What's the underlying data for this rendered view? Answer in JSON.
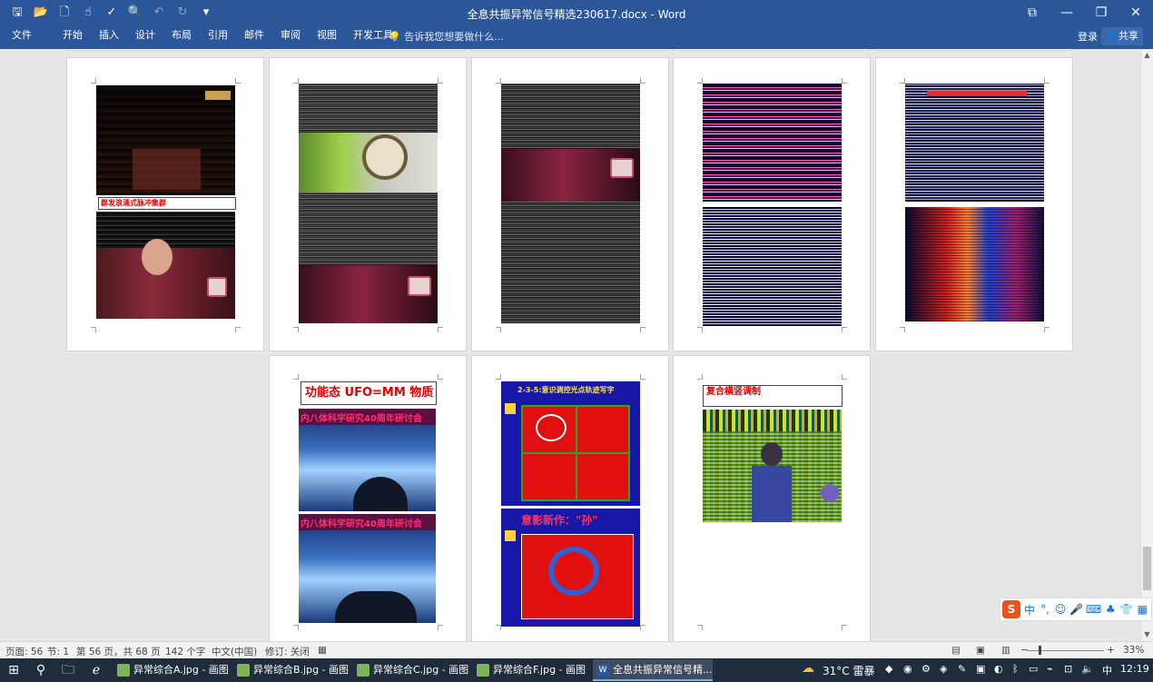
{
  "title_bar": {
    "document_title": "全息共振异常信号精选230617.docx - Word",
    "quick_access": [
      "save-icon",
      "open-icon",
      "new-doc-icon",
      "touch-mode-icon",
      "spelling-icon",
      "print-preview-icon",
      "undo-icon",
      "redo-icon",
      "customize-qat-icon"
    ],
    "window_buttons": [
      "ribbon-display-icon",
      "minimize-icon",
      "restore-icon",
      "close-icon"
    ]
  },
  "ribbon": {
    "tabs": [
      "文件",
      "开始",
      "插入",
      "设计",
      "布局",
      "引用",
      "邮件",
      "审阅",
      "视图",
      "开发工具"
    ],
    "tell_me": "告诉我您想要做什么...",
    "login": "登录",
    "share": "共享"
  },
  "captions": {
    "p1": "群发浪涌式脉冲集群",
    "p6": "功能态 UFO=MM 物质",
    "p6_banner_1": "内八体科学研究40周年研讨会",
    "p6_banner_2": "内八体科学研究40周年研讨会",
    "p7_title_1": "2-3-5:意识调控光点轨迹写字",
    "p7_title_2": "意影新作：\"孙\"",
    "p8": "复合横竖调制"
  },
  "status_bar": {
    "page": "页面: 56",
    "section": "节: 1",
    "page_of": "第 56 页，共 68 页",
    "words": "142 个字",
    "language": "中文(中国)",
    "track_changes": "修订: 关闭",
    "zoom": "33%"
  },
  "ime_bar": {
    "logo": "S",
    "lang": "中",
    "items": [
      "°,",
      "☺",
      "🎤",
      "⌨",
      "♣",
      "👕",
      "▦"
    ]
  },
  "taskbar": {
    "tasks": [
      "异常综合A.jpg - 画图",
      "异常综合B.jpg - 画图",
      "异常综合C.jpg - 画图",
      "异常综合F.jpg - 画图",
      "全息共振异常信号精..."
    ],
    "weather": "31°C 雷暴",
    "time": "12:19",
    "ime": "中"
  },
  "colors": {
    "word_blue": "#2b579a",
    "doc_background": "#e6e6e6",
    "caption_red": "#e00000",
    "taskbar": "#1f2c3c"
  }
}
